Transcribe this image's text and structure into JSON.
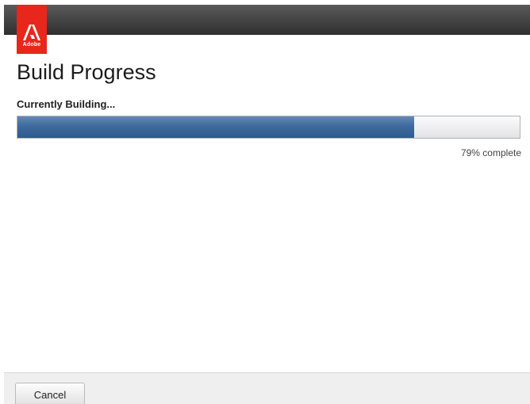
{
  "app": {
    "brand": "Adobe",
    "brand_color": "#e9261c"
  },
  "page": {
    "title": "Build Progress",
    "status": "Currently Building..."
  },
  "progress": {
    "value": 0.79,
    "label": "79% complete",
    "fill_color": "#3f6a9e"
  },
  "footer": {
    "cancel_label": "Cancel"
  },
  "icons": {
    "logo": "adobe-logo-icon"
  }
}
